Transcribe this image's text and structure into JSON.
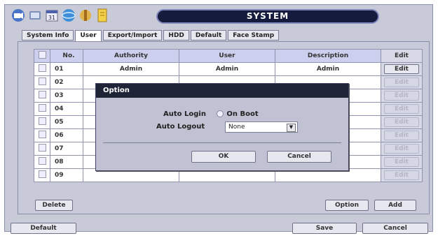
{
  "window": {
    "title": "SYSTEM"
  },
  "toolbar_icons": [
    "camera-icon",
    "playback-icon",
    "calendar-icon",
    "network-icon",
    "tools-icon",
    "log-icon"
  ],
  "tabs": [
    "System Info",
    "User",
    "Export/Import",
    "HDD",
    "Default",
    "Face Stamp"
  ],
  "table": {
    "headers": {
      "no": "No.",
      "authority": "Authority",
      "user": "User",
      "description": "Description",
      "edit": "Edit"
    },
    "rows": [
      {
        "no": "01",
        "authority": "Admin",
        "user": "Admin",
        "description": "Admin",
        "edit": "Edit"
      },
      {
        "no": "02",
        "authority": "",
        "user": "",
        "description": "",
        "edit": "Edit"
      },
      {
        "no": "03",
        "authority": "",
        "user": "",
        "description": "",
        "edit": "Edit"
      },
      {
        "no": "04",
        "authority": "",
        "user": "",
        "description": "",
        "edit": "Edit"
      },
      {
        "no": "05",
        "authority": "",
        "user": "",
        "description": "",
        "edit": "Edit"
      },
      {
        "no": "06",
        "authority": "",
        "user": "",
        "description": "",
        "edit": "Edit"
      },
      {
        "no": "07",
        "authority": "",
        "user": "",
        "description": "",
        "edit": "Edit"
      },
      {
        "no": "08",
        "authority": "",
        "user": "",
        "description": "",
        "edit": "Edit"
      },
      {
        "no": "09",
        "authority": "",
        "user": "",
        "description": "",
        "edit": "Edit"
      }
    ]
  },
  "panel_buttons": {
    "delete": "Delete",
    "option": "Option",
    "add": "Add"
  },
  "bottom_buttons": {
    "default": "Default",
    "save": "Save",
    "cancel": "Cancel"
  },
  "dialog": {
    "title": "Option",
    "auto_login_label": "Auto Login",
    "auto_login_value": "On Boot",
    "auto_logout_label": "Auto Logout",
    "auto_logout_value": "None",
    "ok": "OK",
    "cancel": "Cancel"
  }
}
